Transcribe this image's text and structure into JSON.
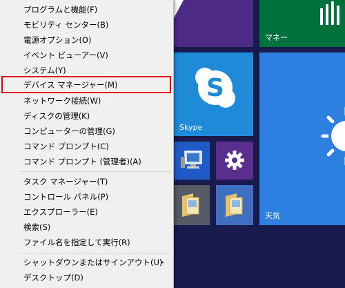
{
  "menu": {
    "items": [
      {
        "label": "プログラムと機能(F)"
      },
      {
        "label": "モビリティ センター(B)"
      },
      {
        "label": "電源オプション(O)"
      },
      {
        "label": "イベント ビューアー(V)"
      },
      {
        "label": "システム(Y)"
      },
      {
        "label": "デバイス マネージャー(M)"
      },
      {
        "label": "ネットワーク接続(W)"
      },
      {
        "label": "ディスクの管理(K)"
      },
      {
        "label": "コンピューターの管理(G)"
      },
      {
        "label": "コマンド プロンプト(C)"
      },
      {
        "label": "コマンド プロンプト (管理者)(A)"
      },
      {
        "label": "タスク マネージャー(T)"
      },
      {
        "label": "コントロール パネル(P)"
      },
      {
        "label": "エクスプローラー(E)"
      },
      {
        "label": "検索(S)"
      },
      {
        "label": "ファイル名を指定して実行(R)"
      },
      {
        "label": "シャットダウンまたはサインアウト(U)",
        "submenu_arrow": "▸"
      },
      {
        "label": "デスクトップ(D)"
      }
    ]
  },
  "tiles": {
    "money_label": "マネー",
    "skype_label": "Skype",
    "weather_label": "天気"
  },
  "colors": {
    "start_bg": "#191a4d",
    "purple_tile": "#5b2d8c",
    "skype_blue": "#1e8ad8",
    "weather_blue": "#2d7fe0",
    "money_green": "#00713c",
    "highlight_red": "#e50012"
  },
  "icons": [
    "skype-logo-icon",
    "gear-icon",
    "desktop-computer-icon",
    "folder-icon",
    "sun-icon",
    "bar-chart-icon"
  ]
}
